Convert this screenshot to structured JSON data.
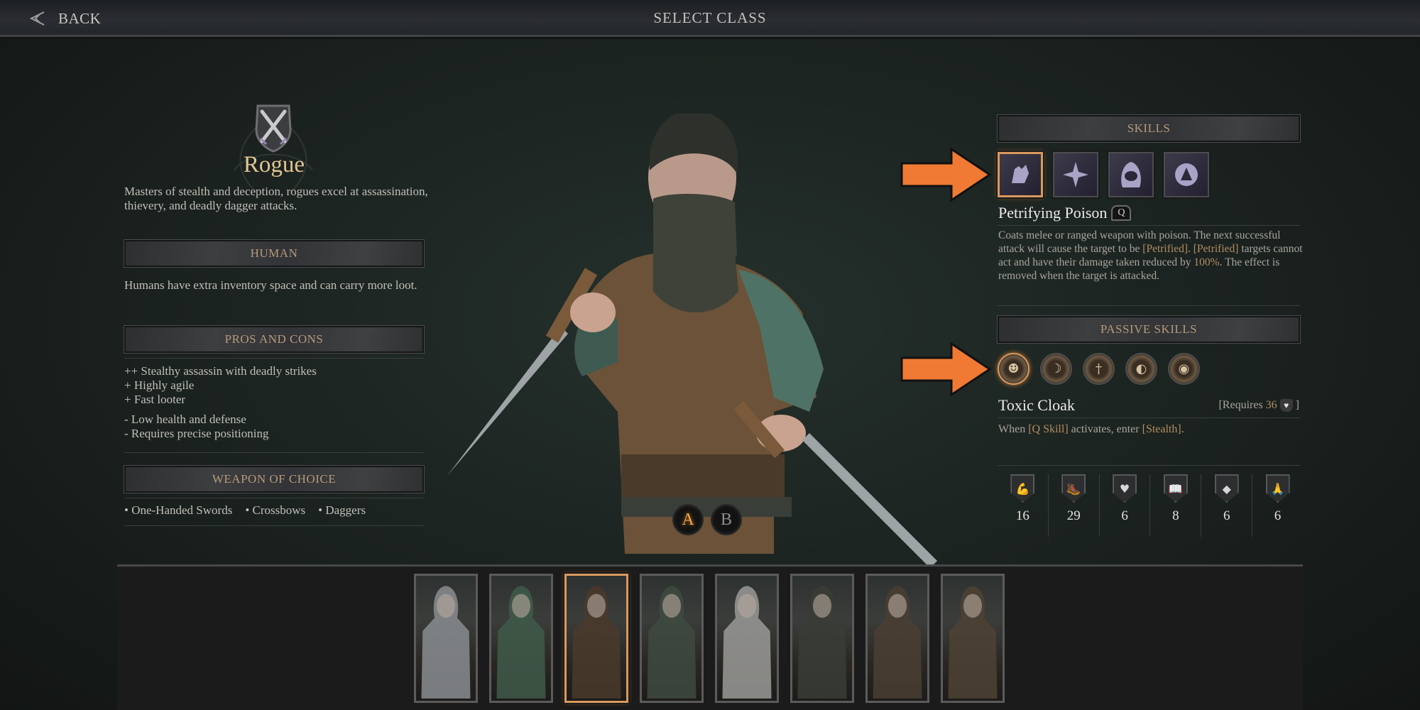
{
  "topbar": {
    "back_label": "BACK",
    "title": "SELECT CLASS"
  },
  "class_info": {
    "name": "Rogue",
    "emblem_icon": "crossed-daggers-shield-icon",
    "description": "Masters of stealth and deception, rogues excel at assassination, thievery, and deadly dagger attacks."
  },
  "race": {
    "header": "HUMAN",
    "description": "Humans have extra inventory space and can carry more loot."
  },
  "pros_cons": {
    "header": "PROS AND CONS",
    "pros": [
      "++ Stealthy assassin with deadly strikes",
      "+ Highly agile",
      "+ Fast looter"
    ],
    "cons": [
      "- Low health and defense",
      "- Requires precise positioning"
    ]
  },
  "weapons": {
    "header": "WEAPON OF CHOICE",
    "items": [
      "• One-Handed Swords",
      "• Crossbows",
      "• Daggers"
    ]
  },
  "variants": {
    "options": [
      "A",
      "B"
    ],
    "selected": "A"
  },
  "skills": {
    "header": "SKILLS",
    "icons": [
      "poison-hand-icon",
      "shadow-strike-icon",
      "hooded-face-icon",
      "smoke-veil-icon"
    ],
    "selected_index": 0,
    "selected_name": "Petrifying Poison",
    "key": "Q",
    "description_parts": [
      {
        "text": "Coats melee or ranged weapon with poison. The next successful attack will cause the target to be ",
        "hl": false
      },
      {
        "text": "[Petrified]",
        "hl": true
      },
      {
        "text": ". ",
        "hl": false
      },
      {
        "text": "[Petrified]",
        "hl": true
      },
      {
        "text": " targets cannot act and have their damage taken reduced by ",
        "hl": false
      },
      {
        "text": "100%",
        "hl": true
      },
      {
        "text": ". The effect is removed when the target is attacked.",
        "hl": false
      }
    ]
  },
  "passive_skills": {
    "header": "PASSIVE SKILLS",
    "icons": [
      "masked-rogue-icon",
      "leaping-figure-icon",
      "blade-icon",
      "split-face-icon",
      "eye-mask-icon"
    ],
    "selected_index": 0,
    "selected_name": "Toxic Cloak",
    "requires_label": "[Requires",
    "requires_value": "36",
    "requires_icon": "vigor-heart-icon",
    "requires_close": "]",
    "description_parts": [
      {
        "text": "When ",
        "hl": false
      },
      {
        "text": "[Q Skill]",
        "hl": true
      },
      {
        "text": " activates, enter ",
        "hl": false
      },
      {
        "text": "[Stealth]",
        "hl": true
      },
      {
        "text": ".",
        "hl": false
      }
    ]
  },
  "stats": [
    {
      "icon": "strength-arm-icon",
      "glyph": "💪",
      "value": "16"
    },
    {
      "icon": "agility-boot-icon",
      "glyph": "🥾",
      "value": "29"
    },
    {
      "icon": "vigor-heart-icon",
      "glyph": "♥",
      "value": "6"
    },
    {
      "icon": "knowledge-book-icon",
      "glyph": "📖",
      "value": "8"
    },
    {
      "icon": "will-shield-icon",
      "glyph": "◆",
      "value": "6"
    },
    {
      "icon": "faith-hands-icon",
      "glyph": "🙏",
      "value": "6"
    }
  ],
  "portraits": {
    "items": [
      "knight-helm",
      "hooded-mustache",
      "masked-rogue",
      "hooded-rogue",
      "skull-armored",
      "skull-hooded",
      "masked-hood-leather",
      "masked-hood-belted"
    ],
    "selected_index": 2
  },
  "annotations": {
    "arrow_color": "#f07a33"
  }
}
